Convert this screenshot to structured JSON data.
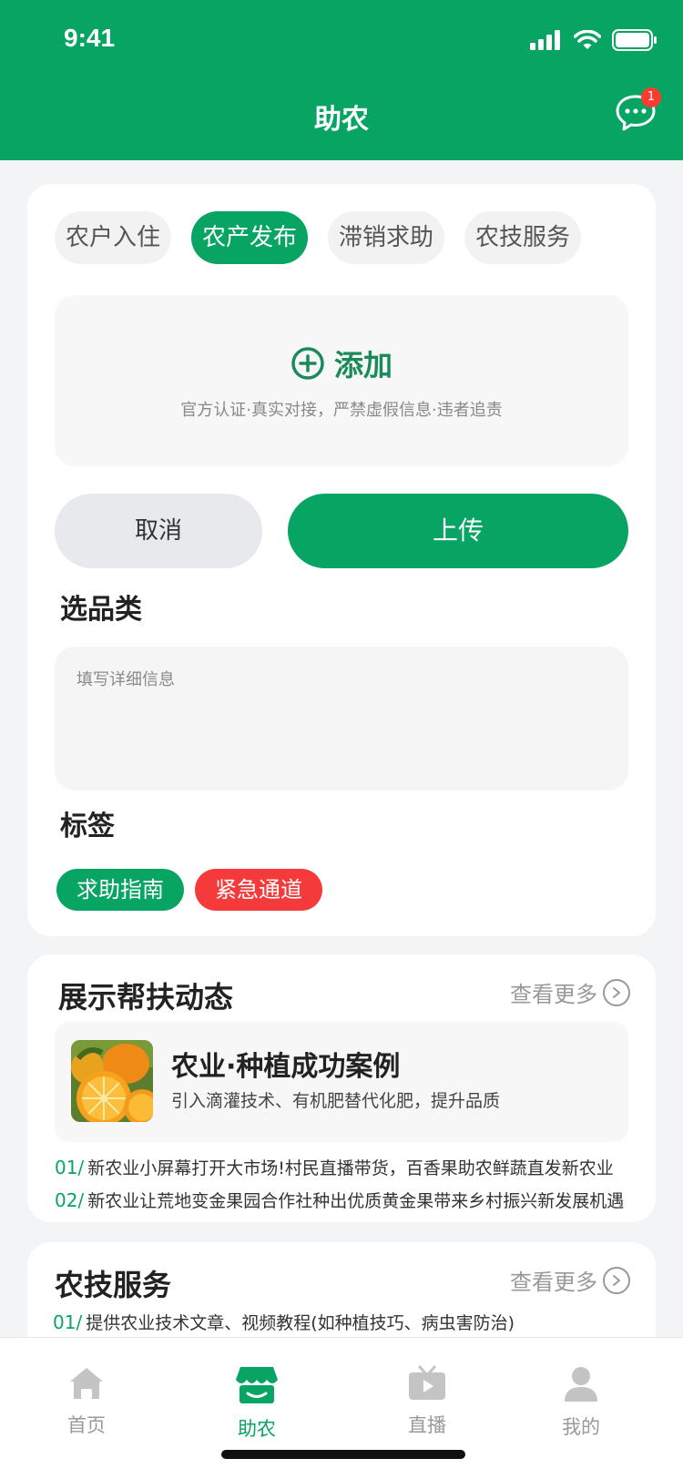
{
  "status_bar": {
    "time": "9:41"
  },
  "header": {
    "title": "助农",
    "badge_count": "1"
  },
  "tabs": [
    {
      "label": "农户入住"
    },
    {
      "label": "农产发布",
      "active": true
    },
    {
      "label": "滞销求助"
    },
    {
      "label": "农技服务"
    }
  ],
  "upload": {
    "add_label": "添加",
    "notice": "官方认证·真实对接，严禁虚假信息·违者追责"
  },
  "actions": {
    "cancel_label": "取消",
    "upload_label": "上传"
  },
  "category": {
    "label": "选品类"
  },
  "detail": {
    "placeholder": "填写详细信息"
  },
  "tags_section": {
    "label": "标签",
    "tags": [
      {
        "label": "求助指南",
        "color": "#07a463"
      },
      {
        "label": "紧急通道",
        "color": "#f43a3a"
      }
    ]
  },
  "dynamics": {
    "title": "展示帮扶动态",
    "more_label": "查看更多",
    "case": {
      "title": "农业·种植成功案例",
      "desc": "引入滴灌技术、有机肥替代化肥，提升品质",
      "image": "orange-image"
    },
    "news": [
      {
        "num": "01/",
        "text": "新农业小屏幕打开大市场!村民直播带货，百香果助农鲜蔬直发新农业"
      },
      {
        "num": "02/",
        "text": "新农业让荒地变金果园合作社种出优质黄金果带来乡村振兴新发展机遇"
      }
    ]
  },
  "tech_service": {
    "title": "农技服务",
    "more_label": "查看更多",
    "items": [
      {
        "num": "01/",
        "text": "提供农业技术文章、视频教程(如种植技巧、病虫害防治)"
      }
    ]
  },
  "tabbar": {
    "items": [
      {
        "label": "首页",
        "icon": "home-icon"
      },
      {
        "label": "助农",
        "icon": "store-icon",
        "active": true
      },
      {
        "label": "直播",
        "icon": "tv-icon"
      },
      {
        "label": "我的",
        "icon": "user-icon"
      }
    ]
  },
  "colors": {
    "brand": "#07a463",
    "danger": "#f43a3a",
    "badge": "#ff3b30"
  }
}
